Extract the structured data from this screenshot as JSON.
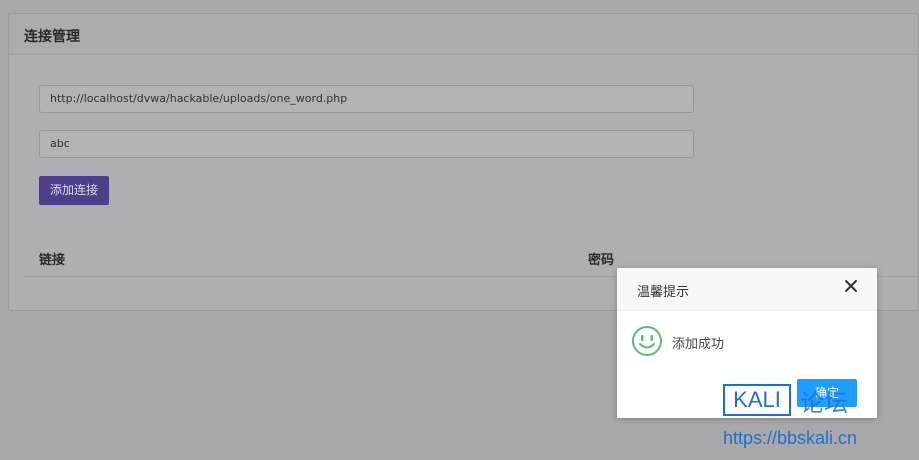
{
  "panel": {
    "title": "连接管理"
  },
  "form": {
    "url_value": "http://localhost/dvwa/hackable/uploads/one_word.php",
    "password_value": "abc",
    "add_button_label": "添加连接"
  },
  "table": {
    "headers": [
      "链接",
      "密码"
    ]
  },
  "dialog": {
    "title": "温馨提示",
    "message": "添加成功",
    "ok_label": "确定",
    "icon": "smile-icon",
    "icon_color": "#5fb878",
    "button_color": "#1e9fff"
  },
  "watermark": {
    "brand": "KALI",
    "suffix": "论坛",
    "url": "https://bbskali.cn"
  },
  "colors": {
    "accent": "#4f3f8a",
    "overlay": "#a9a8ab"
  }
}
